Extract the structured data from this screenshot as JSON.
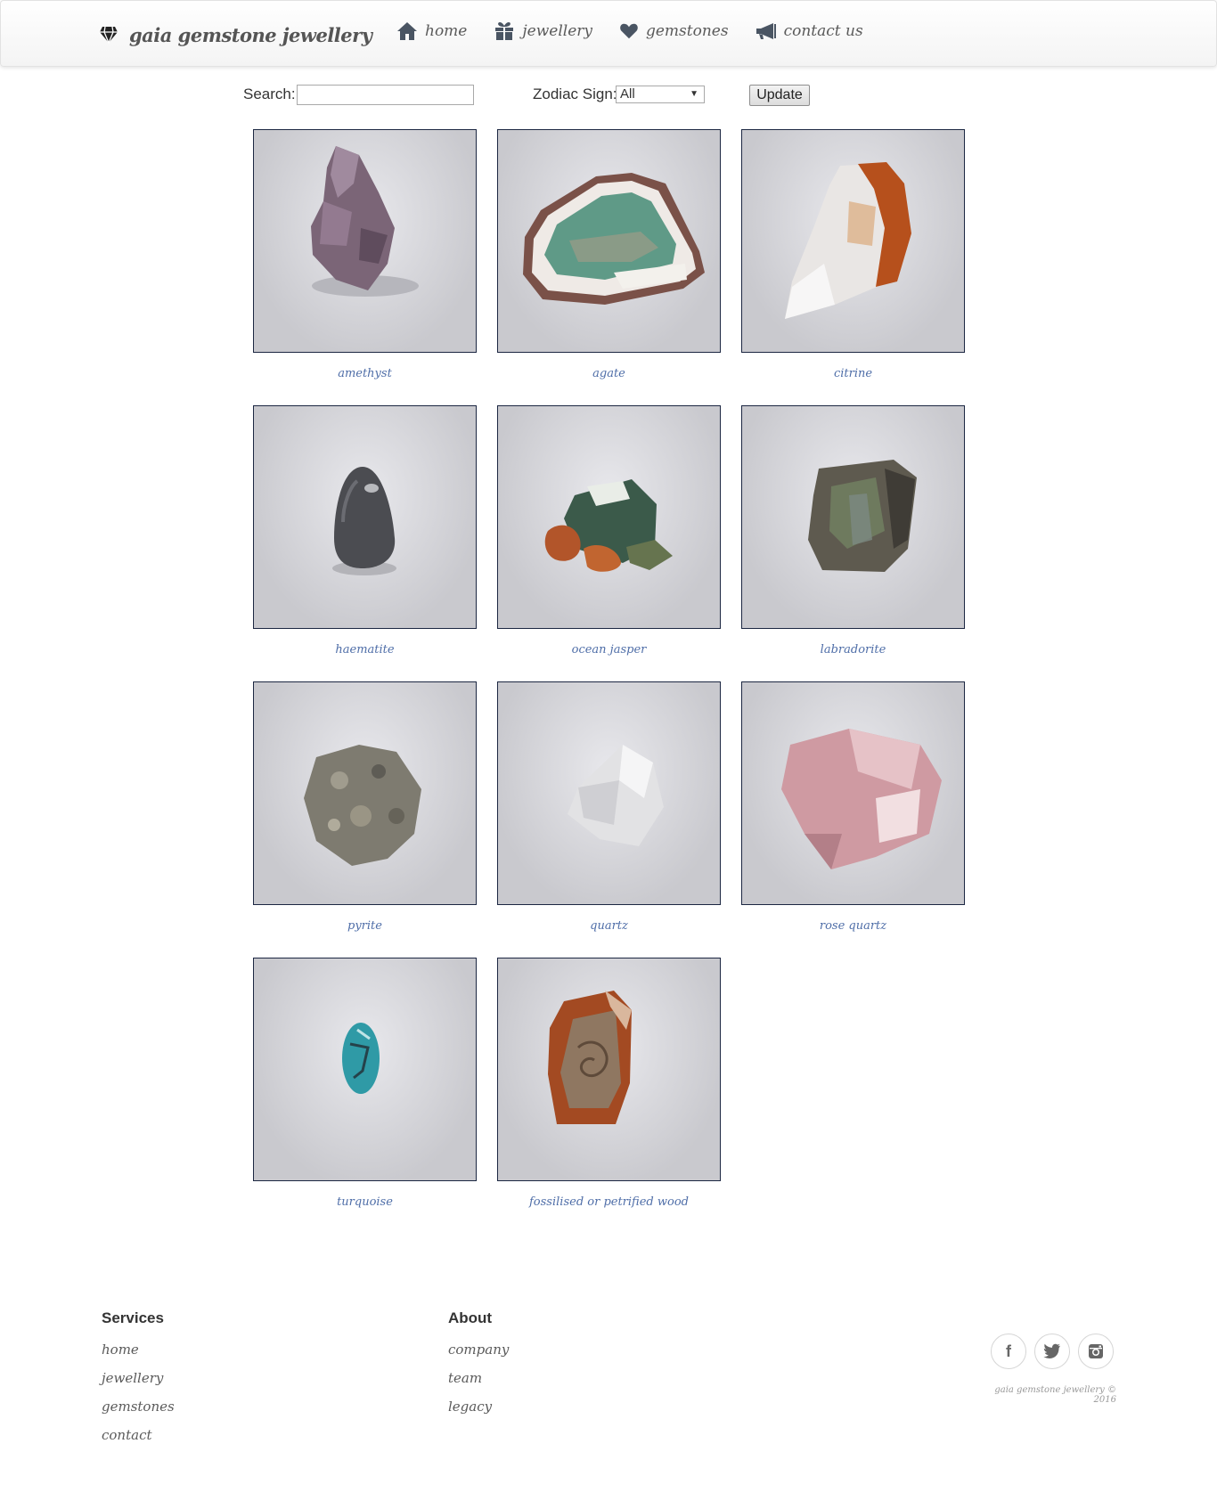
{
  "header": {
    "brand": "gaia gemstone jewellery",
    "nav": [
      {
        "label": "home",
        "icon": "home-icon"
      },
      {
        "label": "jewellery",
        "icon": "gift-icon"
      },
      {
        "label": "gemstones",
        "icon": "heart-icon"
      },
      {
        "label": "contact us",
        "icon": "megaphone-icon"
      }
    ]
  },
  "filters": {
    "search_label": "Search:",
    "search_value": "",
    "zodiac_label": "Zodiac Sign:",
    "zodiac_value": "All",
    "update_label": "Update"
  },
  "gemstones": [
    {
      "name": "amethyst"
    },
    {
      "name": "agate"
    },
    {
      "name": "citrine"
    },
    {
      "name": "haematite"
    },
    {
      "name": "ocean jasper"
    },
    {
      "name": "labradorite"
    },
    {
      "name": "pyrite"
    },
    {
      "name": "quartz"
    },
    {
      "name": "rose quartz"
    },
    {
      "name": "turquoise"
    },
    {
      "name": "fossilised or petrified wood"
    }
  ],
  "footer": {
    "services_heading": "Services",
    "services": [
      "home",
      "jewellery",
      "gemstones",
      "contact"
    ],
    "about_heading": "About",
    "about": [
      "company",
      "team",
      "legacy"
    ],
    "social": [
      "facebook-icon",
      "twitter-icon",
      "instagram-icon"
    ],
    "copyright": "gaia gemstone jewellery © 2016"
  }
}
